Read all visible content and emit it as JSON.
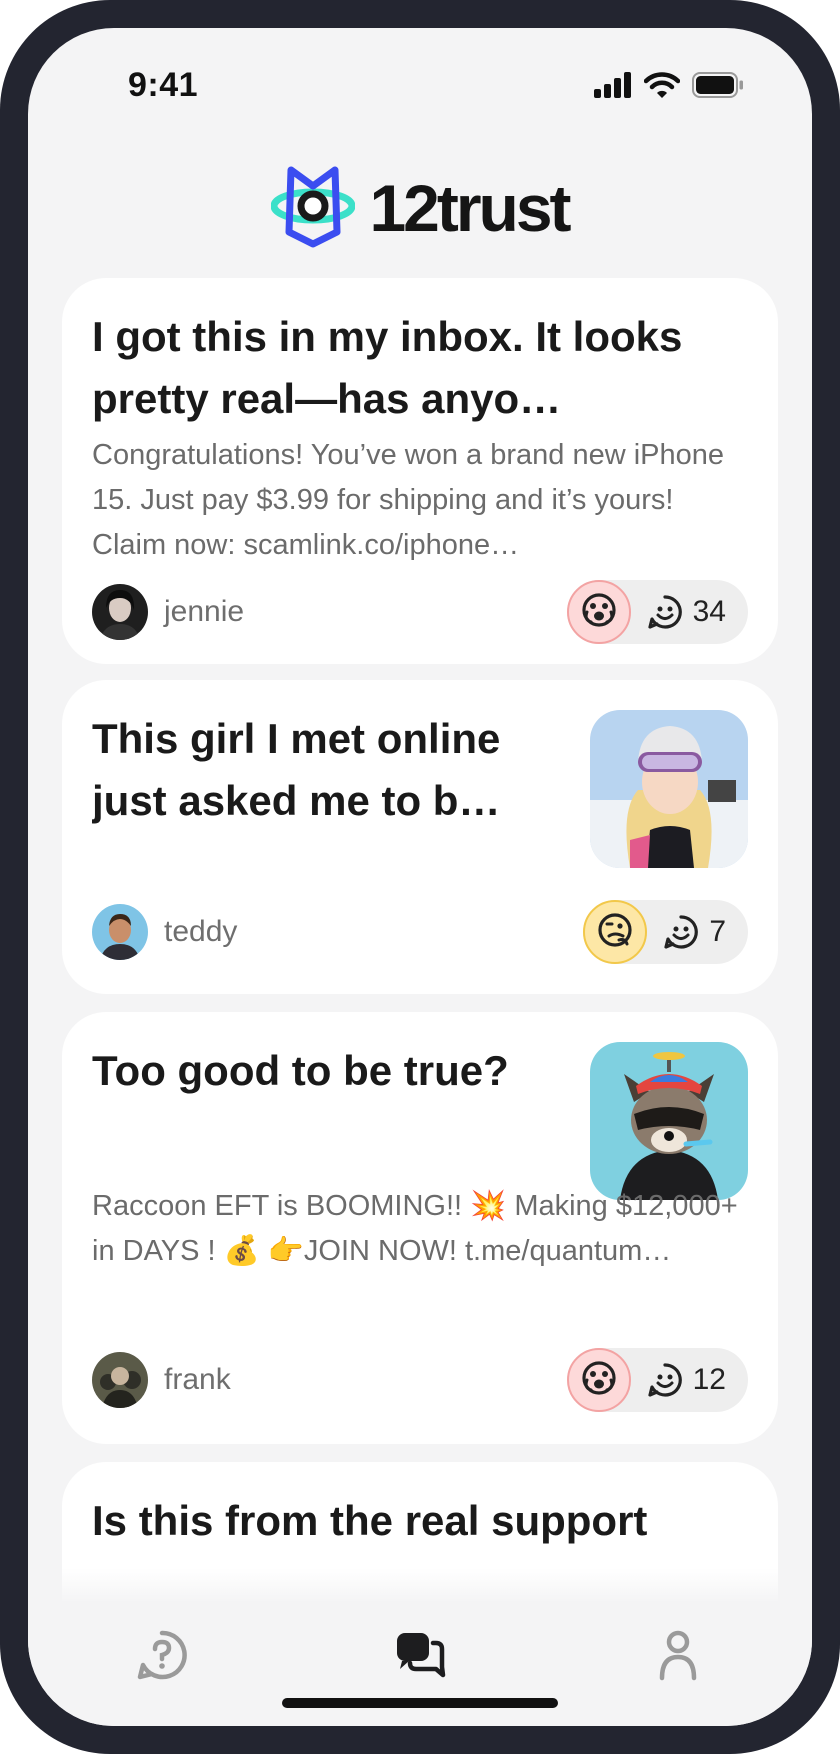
{
  "status_bar": {
    "time": "9:41"
  },
  "app": {
    "name": "12trust"
  },
  "posts": [
    {
      "title": "I got this in my inbox. It looks pretty real—has anyo…",
      "body": "Congratulations! You’ve won a brand new iPhone 15. Just pay $3.99 for shipping and it’s yours! Claim now: scamlink.co/iphone…",
      "author": "jennie",
      "verdict_icon": "scared-face-icon",
      "reaction_count": "34"
    },
    {
      "title": "This girl I met online just asked me to b…",
      "author": "teddy",
      "verdict_icon": "thinking-face-icon",
      "reaction_count": "7"
    },
    {
      "title": "Too good to be true?",
      "body": "Raccoon EFT is BOOMING!! 💥 Making $12,000+ in DAYS ! 💰 👉JOIN NOW! t.me/quantum…",
      "author": "frank",
      "verdict_icon": "scared-face-icon",
      "reaction_count": "12"
    },
    {
      "title": "Is this from the real support"
    }
  ],
  "nav": [
    {
      "icon": "question-icon"
    },
    {
      "icon": "chat-bubbles-icon"
    },
    {
      "icon": "profile-icon"
    }
  ],
  "colors": {
    "badge_red": "#fdd9d9",
    "badge_yellow": "#fde7a6",
    "logo_blue": "#3b4df0",
    "logo_teal": "#3be0c9"
  }
}
